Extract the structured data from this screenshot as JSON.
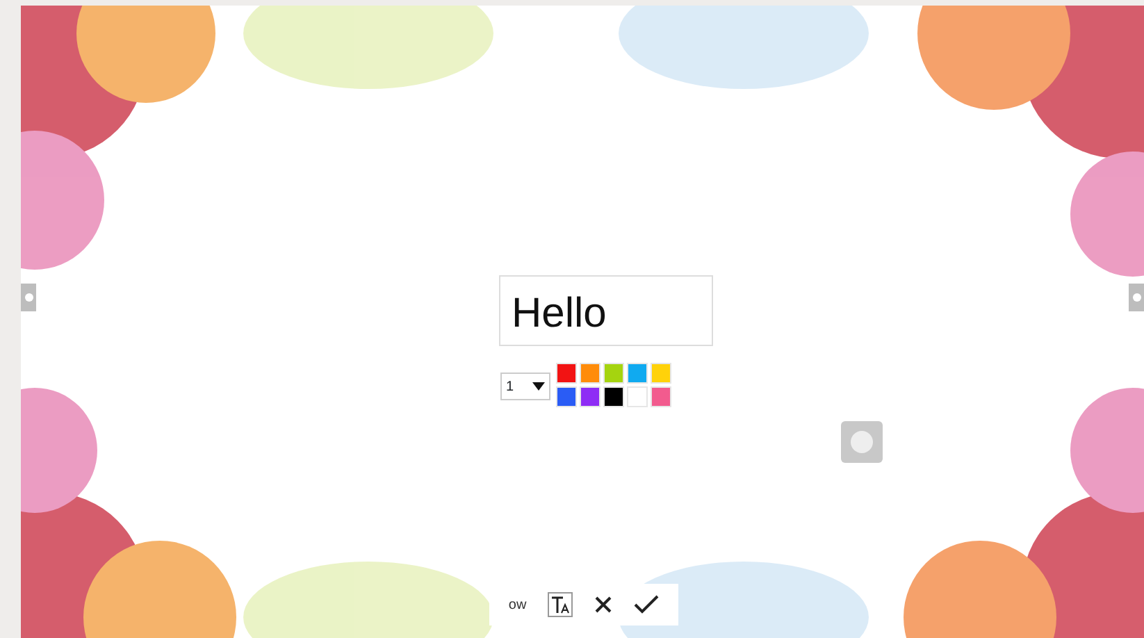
{
  "text_box": {
    "value": "Hello"
  },
  "size_select": {
    "value": "1"
  },
  "palette": [
    {
      "color": "#f21313"
    },
    {
      "color": "#ff8c0a"
    },
    {
      "color": "#a5d40f"
    },
    {
      "color": "#10aaf0"
    },
    {
      "color": "#ffd20a"
    },
    {
      "color": "#2a5cf5"
    },
    {
      "color": "#8e2cf5"
    },
    {
      "color": "#000000"
    },
    {
      "color": "#ffffff"
    },
    {
      "color": "#f25b8e"
    }
  ],
  "toolbar": {
    "partial_label": "ow",
    "buttons": [
      {
        "kind": "text-style"
      },
      {
        "kind": "cancel"
      },
      {
        "kind": "confirm"
      }
    ]
  }
}
